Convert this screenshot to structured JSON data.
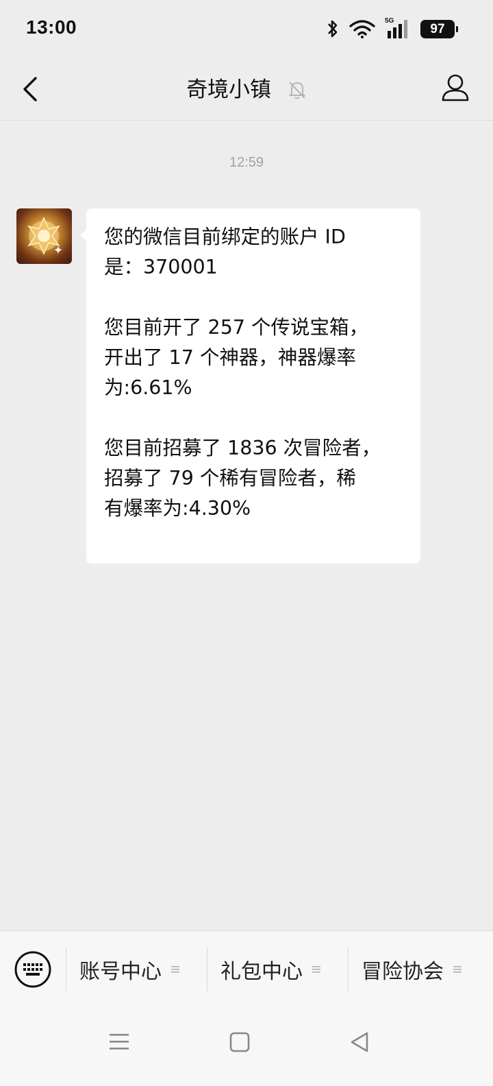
{
  "status_bar": {
    "time": "13:00",
    "network": "5G",
    "battery": "97",
    "icons": [
      "bluetooth-icon",
      "wifi-icon",
      "signal-icon",
      "battery-icon"
    ]
  },
  "nav": {
    "title": "奇境小镇",
    "icons": [
      "back-icon",
      "mute-bell-icon",
      "profile-icon"
    ]
  },
  "chat": {
    "timestamp": "12:59",
    "message": {
      "paragraphs": [
        "您的微信目前绑定的账户 ID\n是：370001",
        "您目前开了 257 个传说宝箱，\n开出了 17 个神器，神器爆率\n为:6.61%",
        "您目前招募了 1836 次冒险者，\n招募了 79 个稀有冒险者，稀\n有爆率为:4.30%"
      ]
    }
  },
  "bottom_menu": {
    "items": [
      {
        "label": "账号中心"
      },
      {
        "label": "礼包中心"
      },
      {
        "label": "冒险协会"
      }
    ]
  },
  "colors": {
    "background": "#ededed",
    "bubble": "#ffffff",
    "menu_bg": "#f7f7f7"
  }
}
